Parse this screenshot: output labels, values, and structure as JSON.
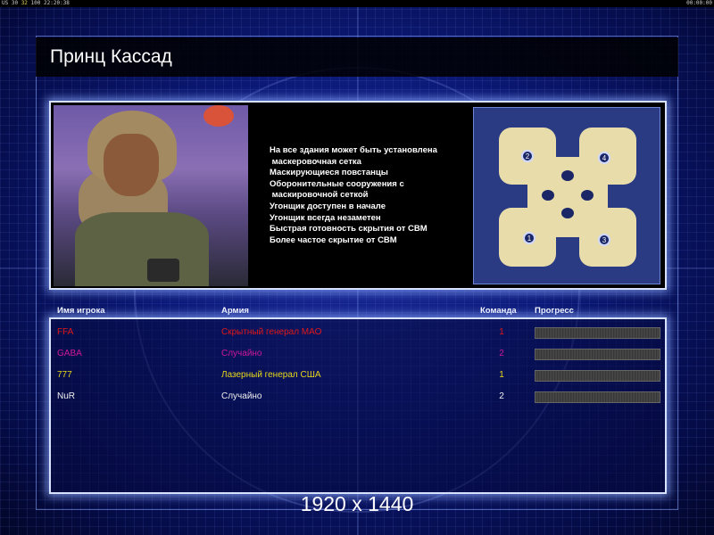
{
  "topbar": {
    "left_stats": "US 30",
    "left_fps": "32",
    "left_extra": "100",
    "left_time": "22:20:38",
    "right_time": "00:00:00"
  },
  "map_briefing": {
    "title": "Принц Кассад",
    "features": [
      "На все здания может быть установлена",
      " маскеровочная сетка",
      "Маскирующиеся повстанцы",
      "Оборонительные сооружения с",
      " маскировочной сеткой",
      "Угонщик доступен в начале",
      "Угонщик всегда незаметен",
      "Быстрая готовность скрытия от СВМ",
      "Более частое скрытие от СВМ"
    ]
  },
  "minimap": {
    "start_positions": [
      "1",
      "2",
      "3",
      "4"
    ]
  },
  "players_table": {
    "headers": {
      "name": "Имя игрока",
      "army": "Армия",
      "team": "Команда",
      "progress": "Прогресс"
    },
    "rows": [
      {
        "name": "FFA",
        "army": "Скрытный генерал МАО",
        "team": "1",
        "color": "#e01818"
      },
      {
        "name": "GABA",
        "army": "Случайно",
        "team": "2",
        "color": "#d0189a"
      },
      {
        "name": "777",
        "army": "Лазерный генерал США",
        "team": "1",
        "color": "#e8d818"
      },
      {
        "name": "NuR",
        "army": "Случайно",
        "team": "2",
        "color": "#f0f0f0"
      }
    ]
  },
  "resolution_label": "1920 x 1440",
  "colors": {
    "panel_glow": "#d6e2ff",
    "background": "#0c1a78"
  }
}
